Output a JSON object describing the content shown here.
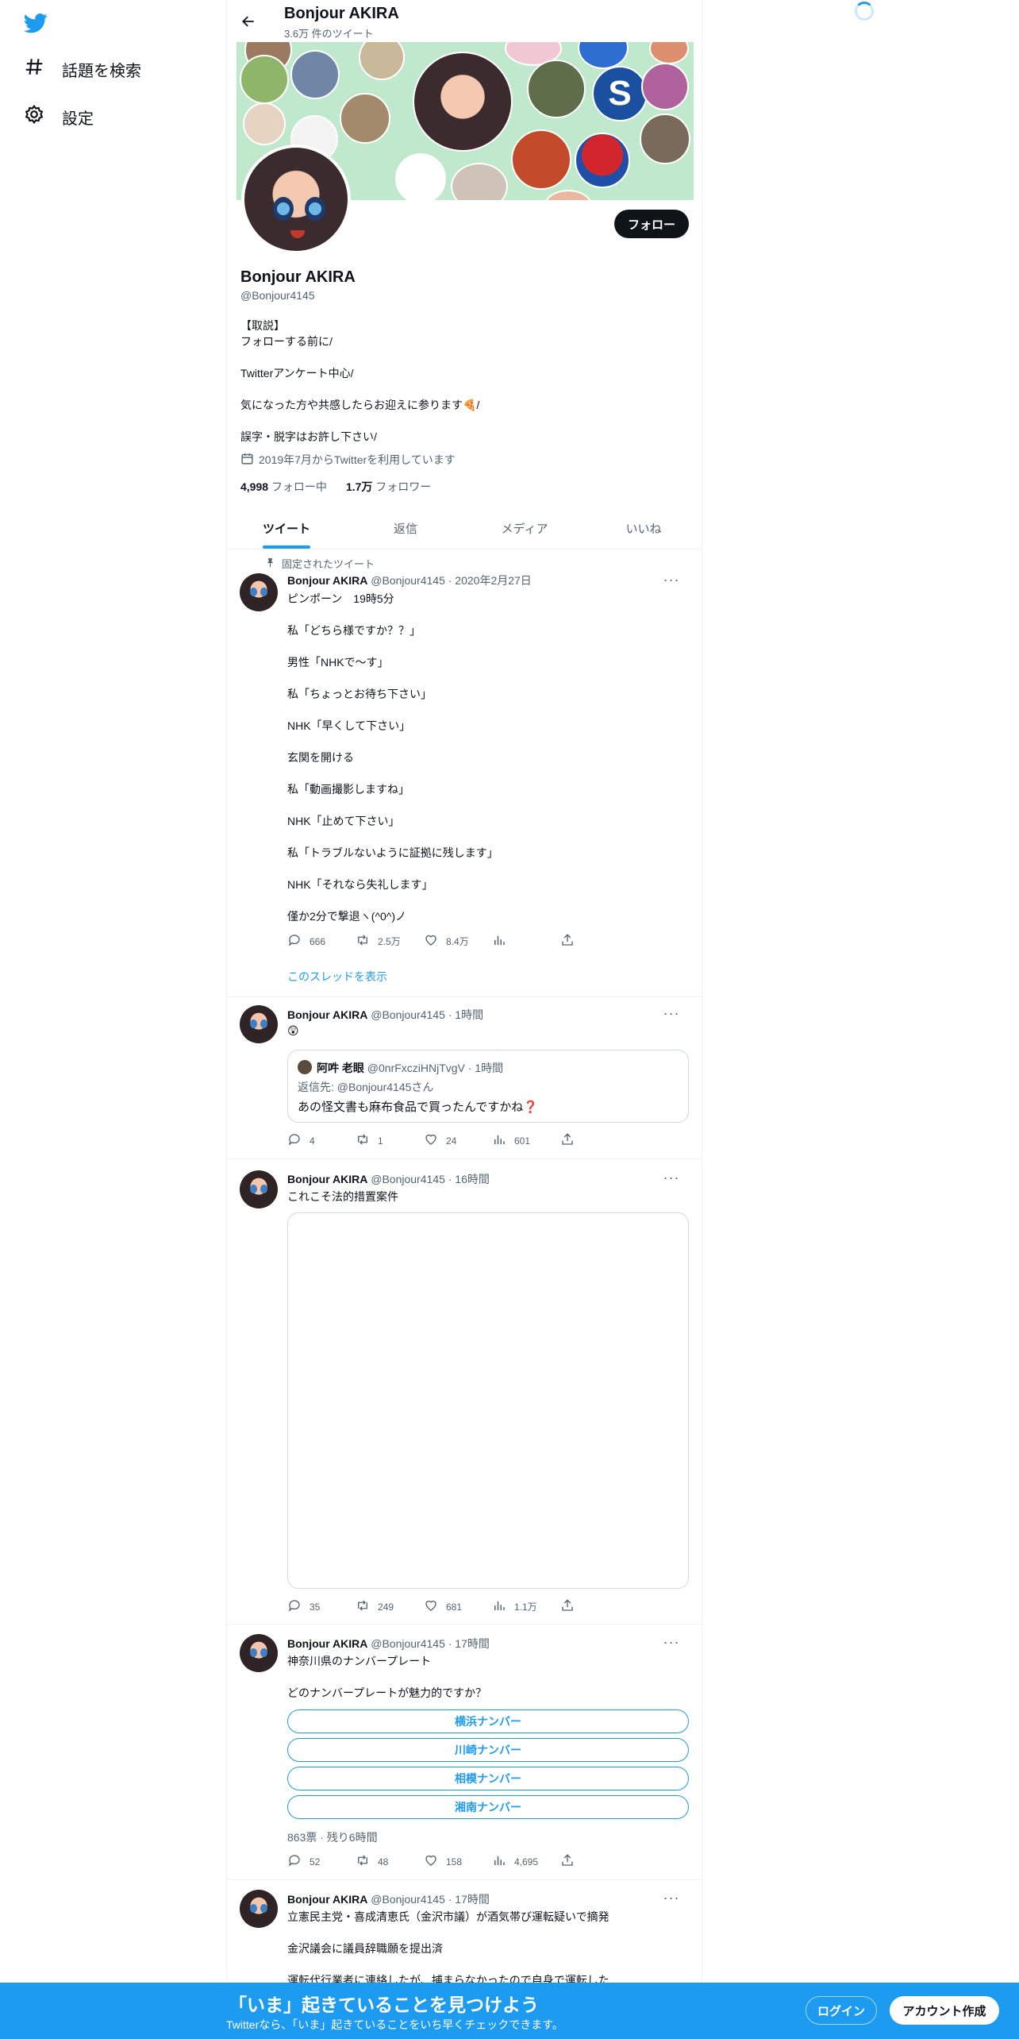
{
  "nav": {
    "explore_label": "話題を検索",
    "settings_label": "設定"
  },
  "header": {
    "name": "Bonjour AKIRA",
    "tweet_count": "3.6万 件のツイート"
  },
  "profile": {
    "name": "Bonjour AKIRA",
    "handle": "@Bonjour4145",
    "follow_label": "フォロー",
    "bio": [
      "【取説】",
      "フォローする前に/",
      "Twitterアンケート中心/",
      "気になった方や共感したらお迎えに参ります🍕/",
      "誤字・脱字はお許し下さい/"
    ],
    "joined": "2019年7月からTwitterを利用しています",
    "following_count": "4,998",
    "following_label": "フォロー中",
    "followers_count": "1.7万",
    "followers_label": "フォロワー"
  },
  "tabs": [
    "ツイート",
    "返信",
    "メディア",
    "いいね"
  ],
  "pinned_label": "固定されたツイート",
  "tweets": [
    {
      "name": "Bonjour AKIRA",
      "meta": "@Bonjour4145 · 2020年2月27日",
      "lines": [
        "ピンポーン　19時5分",
        "私「どちら様ですか？？」",
        "男性「NHKで～す」",
        "私「ちょっとお待ち下さい」",
        "NHK「早くして下さい」",
        "玄関を開ける",
        "私「動画撮影しますね」",
        "NHK「止めて下さい」",
        "私「トラブルないように証拠に残します」",
        "NHK「それなら失礼します」",
        "僅か2分で撃退ヽ(^0^)ノ"
      ],
      "replies": "666",
      "retweets": "2.5万",
      "likes": "8.4万",
      "views": "",
      "thread_label": "このスレッドを表示"
    },
    {
      "name": "Bonjour AKIRA",
      "meta": "@Bonjour4145 · 1時間",
      "lines": [
        "😲"
      ],
      "quote": {
        "name": "阿吽 老眼",
        "meta": "@0nrFxcziHNjTvgV · 1時間",
        "reply_to": "返信先: @Bonjour4145さん",
        "text": "あの怪文書も麻布食品で買ったんですかね❓"
      },
      "replies": "4",
      "retweets": "1",
      "likes": "24",
      "views": "601"
    },
    {
      "name": "Bonjour AKIRA",
      "meta": "@Bonjour4145 · 16時間",
      "lines": [
        "これこそ法的措置案件"
      ],
      "replies": "35",
      "retweets": "249",
      "likes": "681",
      "views": "1.1万"
    },
    {
      "name": "Bonjour AKIRA",
      "meta": "@Bonjour4145 · 17時間",
      "lines": [
        "神奈川県のナンバープレート",
        "どのナンバープレートが魅力的ですか？"
      ],
      "poll": [
        "横浜ナンバー",
        "川崎ナンバー",
        "相模ナンバー",
        "湘南ナンバー"
      ],
      "poll_meta": "863票 · 残り6時間",
      "replies": "52",
      "retweets": "48",
      "likes": "158",
      "views": "4,695"
    },
    {
      "name": "Bonjour AKIRA",
      "meta": "@Bonjour4145 · 17時間",
      "lines": [
        "立憲民主党・喜成清恵氏（金沢市議）が酒気帯び運転疑いで摘発",
        " 金沢議会に議員辞職願を提出済",
        "運転代行業者に連絡したが、捕まらなかったので自身で運転した"
      ]
    }
  ],
  "bottom": {
    "title": "「いま」起きていることを見つけよう",
    "subtitle": "Twitterなら、「いま」起きていることをいち早くチェックできます。",
    "login_label": "ログイン",
    "signup_label": "アカウント作成"
  },
  "colors": {
    "accent": "#1d9bf0",
    "text": "#0f1419",
    "secondary": "#536471"
  },
  "icons": [
    "twitter-logo-icon",
    "hashtag-icon",
    "gear-icon",
    "back-arrow-icon",
    "calendar-icon",
    "pin-icon",
    "reply-icon",
    "retweet-icon",
    "like-icon",
    "views-icon",
    "share-icon",
    "more-icon"
  ]
}
